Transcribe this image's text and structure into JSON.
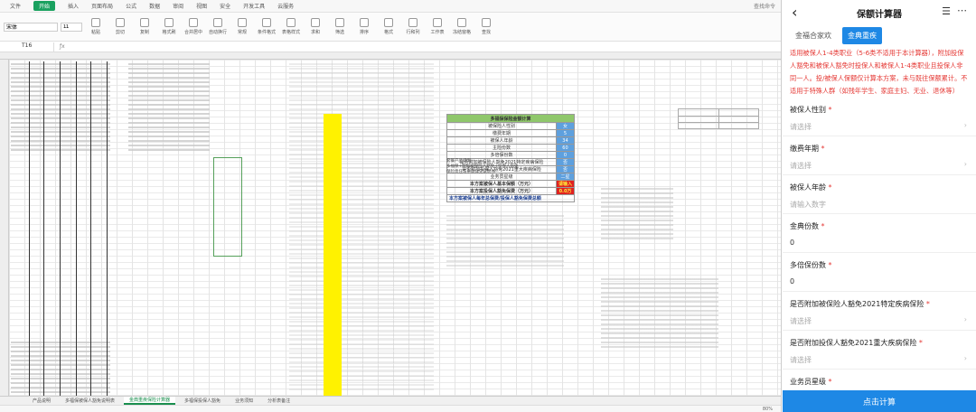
{
  "sheet": {
    "menu": [
      "文件",
      "开始",
      "插入",
      "页面布局",
      "公式",
      "数据",
      "审阅",
      "视图",
      "安全",
      "开发工具",
      "云服务"
    ],
    "menu_active": "开始",
    "search_hint": "查找命令",
    "font_name": "宋体",
    "font_size": "11",
    "ribbon": [
      "粘贴",
      "剪切",
      "复制",
      "格式刷",
      "合并居中",
      "自动换行",
      "常规",
      "条件格式",
      "表格样式",
      "求和",
      "筛选",
      "排序",
      "格式",
      "行和列",
      "工作表",
      "冻结窗格",
      "查找"
    ],
    "name_box": "T16",
    "calc_title": "多福保保险金额计算",
    "calc_rows": [
      {
        "label": "被保险人性别",
        "value": "女"
      },
      {
        "label": "缴费年期",
        "value": "5"
      },
      {
        "label": "被保人年龄",
        "value": "34"
      },
      {
        "label": "主险份数",
        "value": "60"
      },
      {
        "label": "多倍保份数",
        "value": "0"
      },
      {
        "label": "是否附加被保险人豁免2021特定疾病保险",
        "value": "否"
      },
      {
        "label": "是否附加投保人豁免2021重大疾病保险",
        "value": "否"
      },
      {
        "label": "业务员星级",
        "value": "二星"
      }
    ],
    "calc_result_rows": [
      {
        "label": "本方案被保人基本保额（万元）",
        "value": "请输入"
      },
      {
        "label": "本方案投保人豁免保费（万元）",
        "value": "0.0万"
      }
    ],
    "calc_footer": "本方案被保人每年总保费/投保人豁免保费总额",
    "notes_mid": "套餐产品说明\n多福保+附加被保险人豁免+投保人豁免\n保险责任与条款详见说明书",
    "notes_right": "",
    "tabs": [
      "产品说明",
      "多福保被保人豁免说明表",
      "金典重疾保险计算器",
      "多福保投保人豁免",
      "业务须知",
      "分析表备注"
    ],
    "tab_active": "金典重疾保险计算器",
    "zoom": "80%"
  },
  "mobile": {
    "title": "保额计算器",
    "back_icon": "‹",
    "menu_icon": "☰",
    "more_icon": "⋯",
    "tabs": [
      "金福合家欢",
      "金典重疾"
    ],
    "tab_active": "金典重疾",
    "notice": "适用被保人1-4类职业（5-6类不适用于本计算器），附加投保人豁免和被保人豁免时投保人和被保人1-4类职业且投保人非同一人。投/被保人保额仅计算本方案，未与既往保额累计。不适用于特殊人群（如残年学生、家庭主妇、无业、退休等）",
    "fields": [
      {
        "label": "被保人性别",
        "required": true,
        "value": "请选择",
        "kind": "select"
      },
      {
        "label": "缴费年期",
        "required": true,
        "value": "请选择",
        "kind": "select"
      },
      {
        "label": "被保人年龄",
        "required": true,
        "value": "请输入数字",
        "kind": "input"
      },
      {
        "label": "金典份数",
        "required": true,
        "value": "0",
        "kind": "number"
      },
      {
        "label": "多倍保份数",
        "required": true,
        "value": "0",
        "kind": "number"
      },
      {
        "label": "是否附加被保险人豁免2021特定疾病保险",
        "required": true,
        "value": "请选择",
        "kind": "select"
      },
      {
        "label": "是否附加投保人豁免2021重大疾病保险",
        "required": true,
        "value": "请选择",
        "kind": "select"
      },
      {
        "label": "业务员星级",
        "required": true,
        "value": "请选择",
        "kind": "select"
      }
    ],
    "submit_label": "点击计算",
    "accent_color": "#1e88e5",
    "notice_color": "#e53935"
  }
}
